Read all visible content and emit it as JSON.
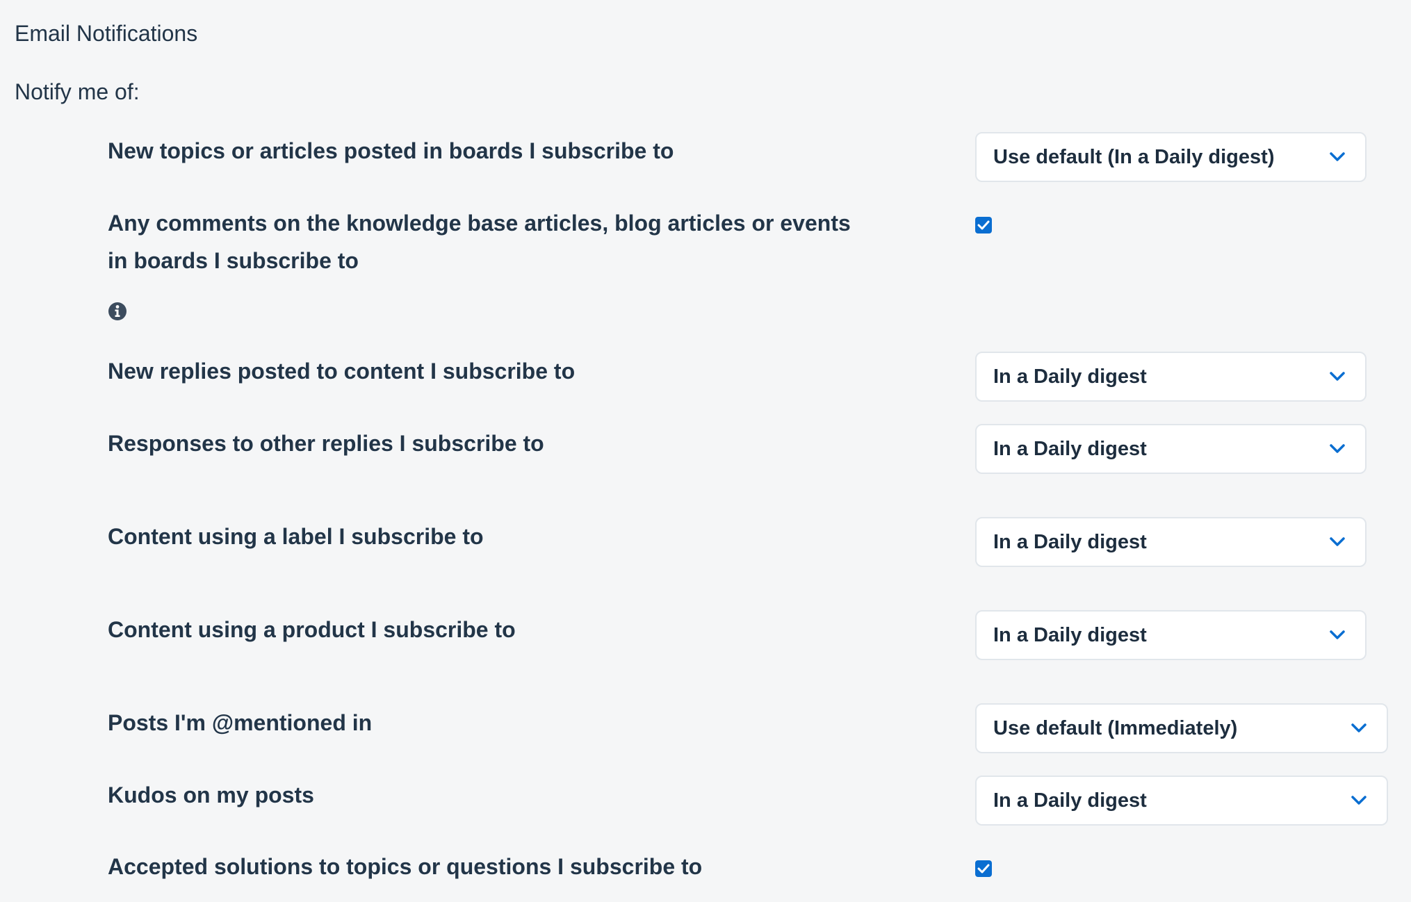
{
  "header": {
    "title": "Email Notifications",
    "notify_label": "Notify me of:"
  },
  "options": [
    {
      "label": "New topics or articles posted in boards I subscribe to",
      "control": "select",
      "value": "Use default (In a Daily digest)"
    },
    {
      "label": "Any comments on the knowledge base articles, blog articles or events in boards I subscribe to",
      "control": "checkbox",
      "checked": true
    },
    {
      "label": "New replies posted to content I subscribe to",
      "control": "select",
      "value": "In a Daily digest"
    },
    {
      "label": "Responses to other replies I subscribe to",
      "control": "select",
      "value": "In a Daily digest"
    },
    {
      "label": "Content using a label I subscribe to",
      "control": "select",
      "value": "In a Daily digest"
    },
    {
      "label": "Content using a product I subscribe to",
      "control": "select",
      "value": "In a Daily digest"
    },
    {
      "label": "Posts I'm @mentioned in",
      "control": "select",
      "value": "Use default (Immediately)"
    },
    {
      "label": "Kudos on my posts",
      "control": "select",
      "value": "In a Daily digest"
    },
    {
      "label": "Accepted solutions to topics or questions I subscribe to",
      "control": "checkbox",
      "checked": true
    }
  ],
  "icons": {
    "info": "info-icon",
    "chevron": "chevron-down-icon",
    "check": "checkmark-icon"
  },
  "colors": {
    "background": "#f5f6f7",
    "text": "#223548",
    "accent": "#0a6ed1",
    "select_border": "#e1e6eb"
  }
}
